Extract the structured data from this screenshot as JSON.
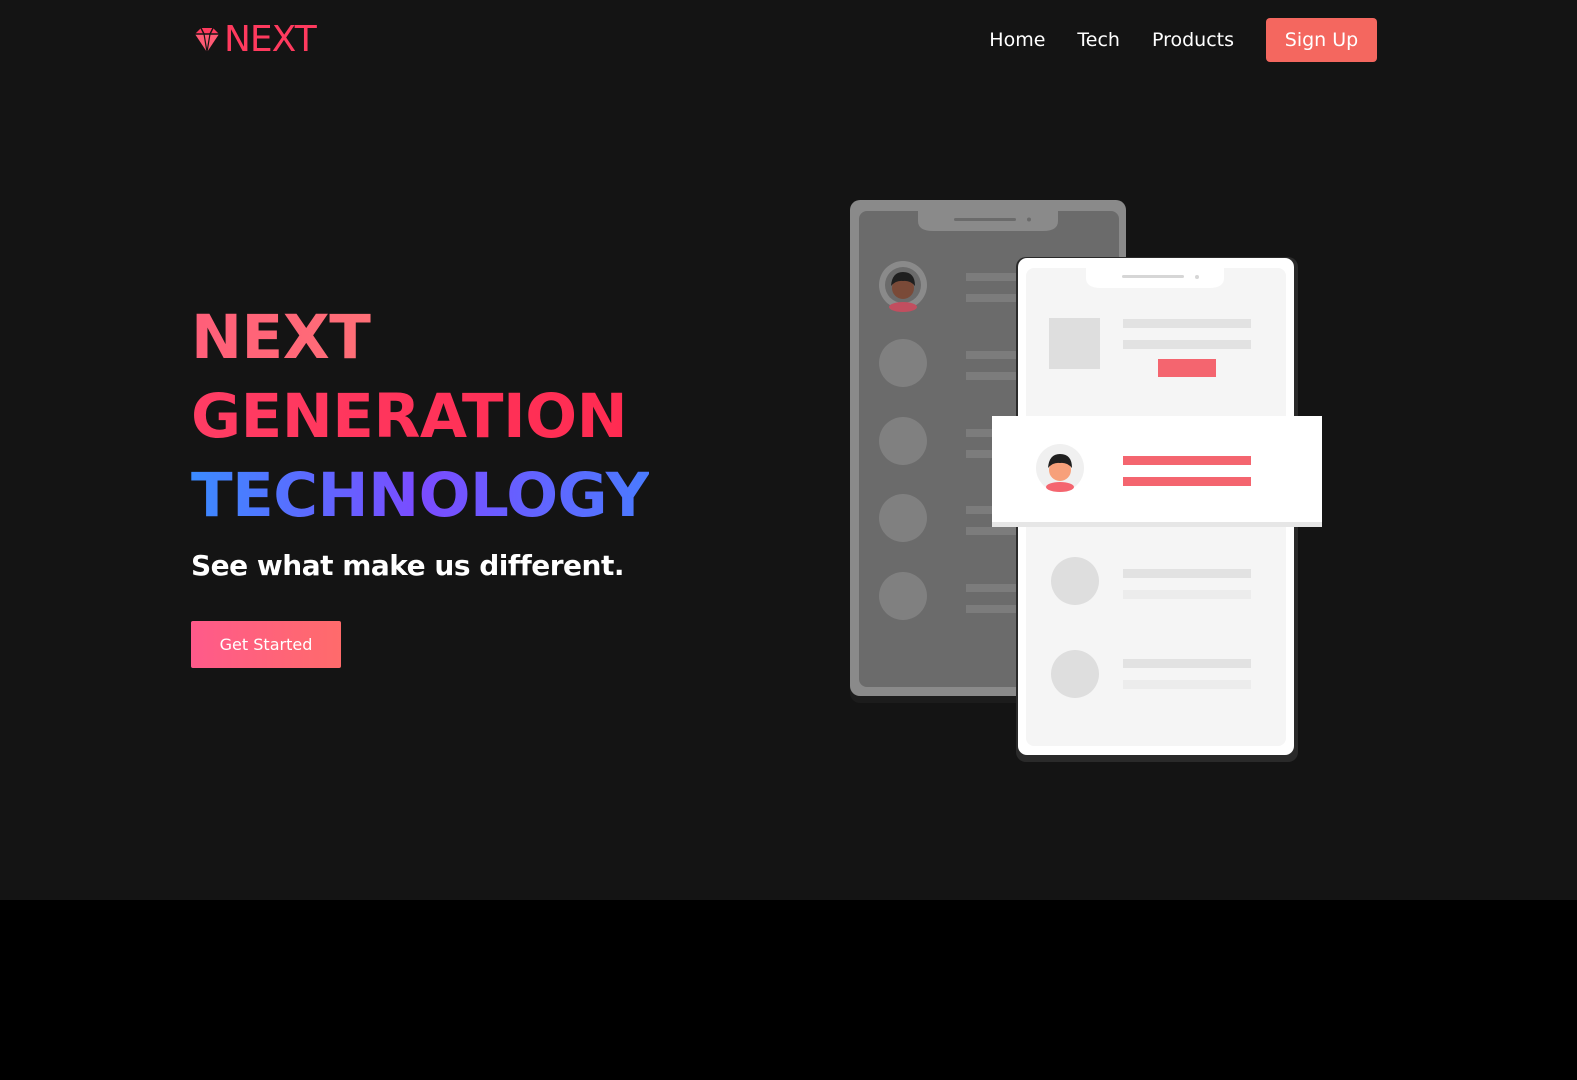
{
  "brand": {
    "logo_text": "NEXT",
    "logo_icon": "diamond-icon",
    "accent": "#ff3a5e"
  },
  "nav": {
    "links": [
      {
        "label": "Home"
      },
      {
        "label": "Tech"
      },
      {
        "label": "Products"
      }
    ],
    "signup_label": "Sign Up",
    "signup_color": "#f4675f"
  },
  "hero": {
    "line1": "NEXT",
    "line2": "GENERATION",
    "line3": "TECHNOLOGY",
    "subtitle": "See what make us different.",
    "cta_label": "Get Started"
  },
  "colors": {
    "background": "#141414",
    "card_red": "#f4656f"
  }
}
